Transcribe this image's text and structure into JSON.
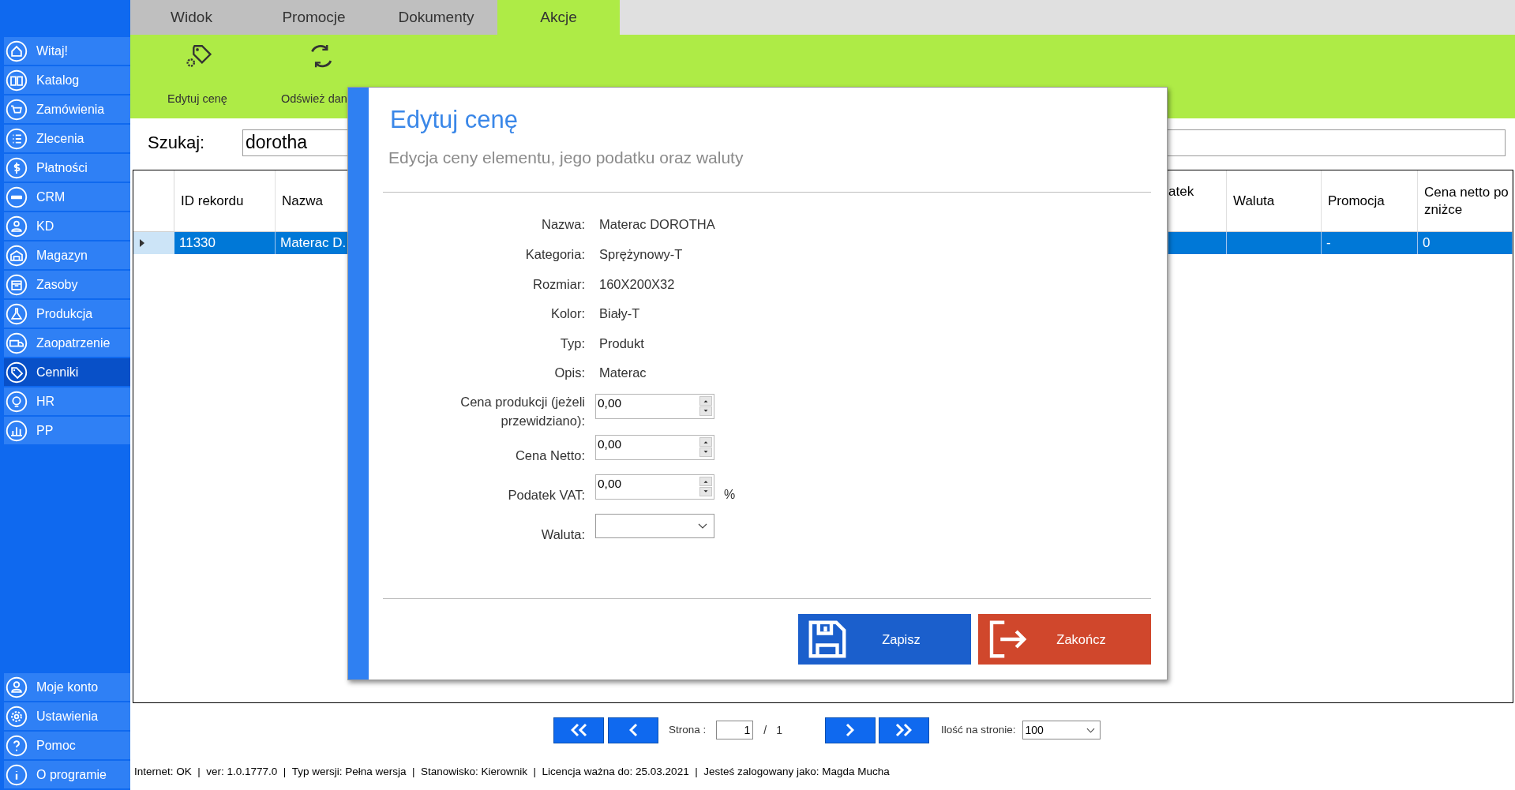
{
  "sidebar": {
    "items": [
      {
        "label": "Witaj!",
        "selected": false
      },
      {
        "label": "Katalog",
        "selected": false
      },
      {
        "label": "Zamówienia",
        "selected": false
      },
      {
        "label": "Zlecenia",
        "selected": false
      },
      {
        "label": "Płatności",
        "selected": false
      },
      {
        "label": "CRM",
        "selected": false
      },
      {
        "label": "KD",
        "selected": false
      },
      {
        "label": "Magazyn",
        "selected": false
      },
      {
        "label": "Zasoby",
        "selected": false
      },
      {
        "label": "Produkcja",
        "selected": false
      },
      {
        "label": "Zaopatrzenie",
        "selected": false
      },
      {
        "label": "Cenniki",
        "selected": true
      },
      {
        "label": "HR",
        "selected": false
      },
      {
        "label": "PP",
        "selected": false
      }
    ],
    "bottom_items": [
      {
        "label": "Moje konto",
        "selected": false
      },
      {
        "label": "Ustawienia",
        "selected": false
      },
      {
        "label": "Pomoc",
        "selected": false
      },
      {
        "label": "O programie",
        "selected": false
      }
    ]
  },
  "tabs": [
    {
      "label": "Widok",
      "selected": false
    },
    {
      "label": "Promocje",
      "selected": false
    },
    {
      "label": "Dokumenty",
      "selected": false
    },
    {
      "label": "Akcje",
      "selected": true
    }
  ],
  "ribbon": {
    "buttons": [
      {
        "label": "Edytuj cenę",
        "kind": "edit-price"
      },
      {
        "label": "Odśwież dan",
        "kind": "refresh"
      }
    ]
  },
  "search": {
    "label": "Szukaj:",
    "value": "dorotha"
  },
  "table": {
    "columns": [
      "ID rekordu",
      "Nazwa",
      "atek",
      "Waluta",
      "Promocja",
      "Cena netto po zniżce"
    ],
    "rows": [
      {
        "selected": true,
        "cells": [
          "11330",
          "Materac D.",
          "",
          "",
          "-",
          "0"
        ]
      }
    ]
  },
  "dialog": {
    "title": "Edytuj cenę",
    "subtitle": "Edycja ceny elementu, jego podatku oraz waluty",
    "fields": [
      {
        "label": "Nazwa:",
        "value": "Materac DOROTHA"
      },
      {
        "label": "Kategoria:",
        "value": "Sprężynowy-T"
      },
      {
        "label": "Rozmiar:",
        "value": "160X200X32"
      },
      {
        "label": "Kolor:",
        "value": "Biały-T"
      },
      {
        "label": "Typ:",
        "value": "Produkt"
      },
      {
        "label": "Opis:",
        "value": "Materac"
      }
    ],
    "inputs": [
      {
        "kind": "spinner",
        "label": "Cena produkcji (jeżeli przewidziano):",
        "value": "0,00"
      },
      {
        "kind": "spinner",
        "label": "Cena Netto:",
        "value": "0,00"
      },
      {
        "kind": "spinner",
        "label": "Podatek VAT:",
        "value": "0,00",
        "suffix": "%"
      },
      {
        "kind": "dropdown",
        "label": "Waluta:"
      }
    ],
    "buttons": [
      {
        "label": "Zapisz",
        "kind": "save"
      },
      {
        "label": "Zakończ",
        "kind": "exit"
      }
    ]
  },
  "pagination": {
    "page_label": "Strona :",
    "page": "1",
    "separator": "/",
    "total": "1",
    "per_page_label": "Ilość na stronie:",
    "per_page": "100"
  },
  "status_bar": "Internet: OK  |  ver: 1.0.1777.0  |  Typ wersji: Pełna wersja  |  Stanowisko: Kierownik  |  Licencja ważna do: 25.03.2021  |  Jesteś zalogowany jako: Magda Mucha"
}
